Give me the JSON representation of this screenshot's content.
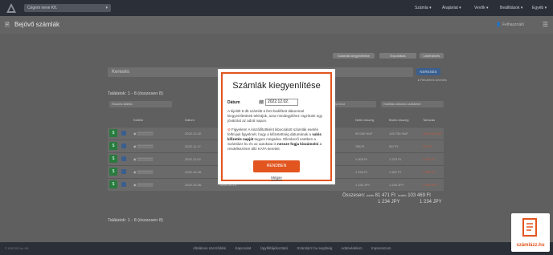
{
  "header": {
    "company_select": "Cégem neve Kft.",
    "nav": [
      "Számla",
      "Árajánlat",
      "Vevők",
      "Beállítások",
      "Egyéb"
    ]
  },
  "page": {
    "title": "Bejövő számlák",
    "user": "Felhasználó",
    "pills": [
      "Számlák kiegyenlítése",
      "Exportálás",
      "Lekérdezés"
    ],
    "search_placeholder": "Keresés",
    "search_button": "KERESÉS",
    "advanced_search": "Részletes keresés",
    "count_top": "Találatok: 1 - 8 (összesen 8)",
    "count_bottom": "Találatok: 1 - 8 (összesen 8)",
    "filters": [
      "Összes kiállító",
      "Összes fizetési mód",
      "Kiállítás dátuma csökkenő"
    ],
    "columns": [
      "Kiállító",
      "Dátum",
      "Határidő",
      "Nettó összeg",
      "Bruttó összeg",
      "Tartozás"
    ]
  },
  "rows": [
    {
      "date": "2022.12.02.",
      "due": "2022.12.10.",
      "net": "99 000 HUF",
      "gross": "125 730 HUF",
      "debt": "125 730 HUF"
    },
    {
      "date": "2022.11.17.",
      "due": "2022.11.25.",
      "net": "785 Ft",
      "gross": "997 Ft",
      "debt": "997 Ft"
    },
    {
      "date": "2022.11.02.",
      "due": "2022.11.10.",
      "net": "1 000 Ft",
      "gross": "1 270 Ft",
      "debt": "1 270 Ft"
    },
    {
      "date": "2022.10.18.",
      "due": "2022.10.26.",
      "net": "1 234 Ft",
      "gross": "1 567 Ft",
      "debt": "1 567 Ft"
    },
    {
      "date": "2022.10.05.",
      "due": "2022.10.13.",
      "net": "1 234 JPY",
      "gross": "1 234 JPY",
      "debt": "1 234 JPY"
    }
  ],
  "summary": {
    "label": "Összesen:",
    "net_label": "nettó",
    "net_value": "81 471 Ft",
    "gross_label": "bruttó",
    "gross_value": "103 469 Ft",
    "currency_net": "1 234 JPY",
    "currency_gross": "1 234 JPY"
  },
  "footer": {
    "copyright": "© KBOSS.hu Kft.",
    "links": [
      "Általános szerződési",
      "Kapcsolat",
      "Ügyféltájékoztató",
      "Számlázz.hu segítség",
      "Adatvédelem",
      "Impresszum"
    ]
  },
  "brand": {
    "name": "számlázz.hu"
  },
  "modal": {
    "title": "Számlák kiegyenlítése",
    "date_label": "Dátum",
    "date_value": "2022.12.02.",
    "info": "A kijelölt 5 db számlát a fent beállított dátummal kiegyenlítettnek tekintjük, azaz mindegyikhez rögzítünk egy jóváírást az adott napon.",
    "warn_a": "Figyelem! A kiszállítottként kibocsátott számlák esetén felhívjuk figyelmét, hogy a kifizetettség dátumának a",
    "warn_b": "valós kifizetés napját",
    "warn_c": "tegyen megadva. Ellenkező esetben a Számlázz.hu és az autokata is",
    "warn_d": "nessze fogja kiszámolni",
    "warn_e": "a rendelkezésre álló KATA kereteit.",
    "confirm": "RENDBEN",
    "cancel": "Mégse"
  },
  "colors": {
    "accent": "#e2551f",
    "topbar": "#2b2f38",
    "overlay": "#5f5f5f"
  }
}
